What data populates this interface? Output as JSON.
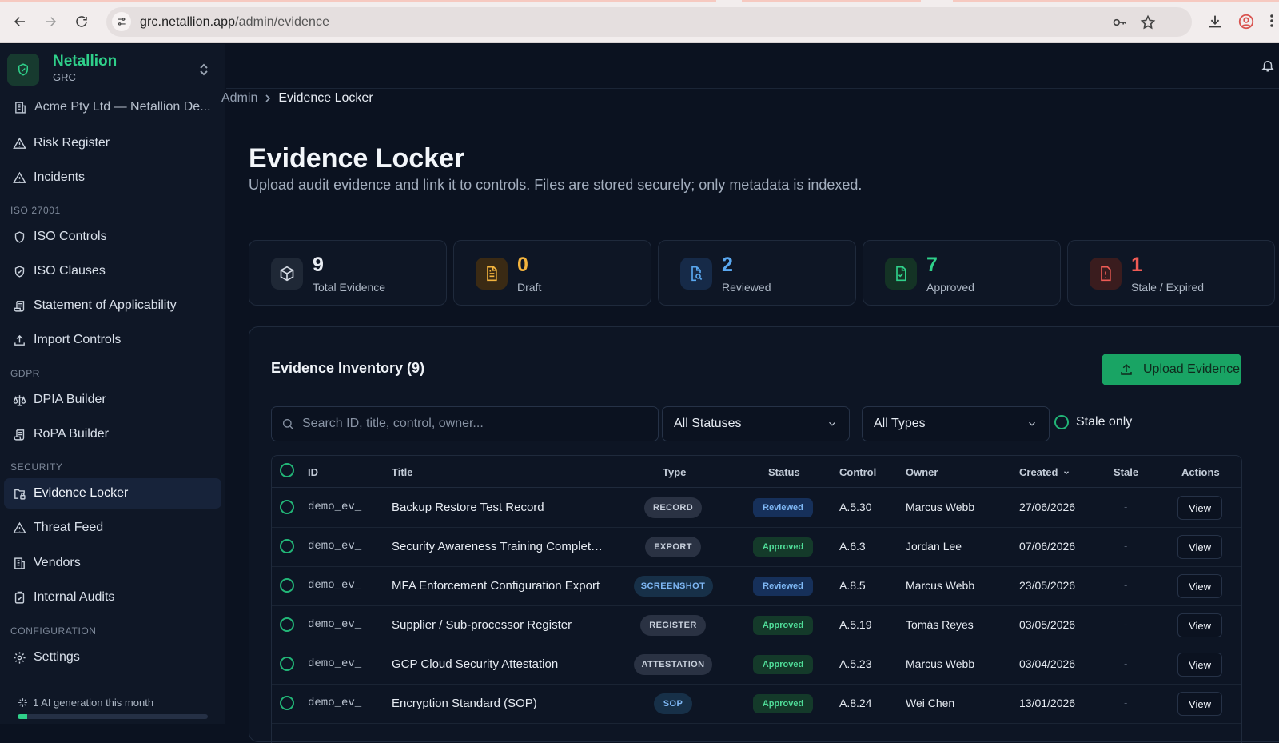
{
  "browser": {
    "url_host": "grc.netallion.app",
    "url_path": "/admin/evidence"
  },
  "brand": {
    "name": "Netallion",
    "sub": "GRC"
  },
  "org": "Acme Pty Ltd — Netallion De...",
  "nav": {
    "risk_register": "Risk Register",
    "incidents": "Incidents",
    "section_iso": "ISO 27001",
    "iso_controls": "ISO Controls",
    "iso_clauses": "ISO Clauses",
    "soa": "Statement of Applicability",
    "import_controls": "Import Controls",
    "section_gdpr": "GDPR",
    "dpia": "DPIA Builder",
    "ropa": "RoPA Builder",
    "section_security": "SECURITY",
    "evidence_locker": "Evidence Locker",
    "threat_feed": "Threat Feed",
    "vendors": "Vendors",
    "internal_audits": "Internal Audits",
    "section_config": "CONFIGURATION",
    "settings": "Settings"
  },
  "ai_usage": {
    "label": "1 AI generation this month",
    "fraction": 0.05
  },
  "breadcrumb": {
    "parent": "Admin",
    "current": "Evidence Locker"
  },
  "page": {
    "title": "Evidence Locker",
    "subtitle": "Upload audit evidence and link it to controls. Files are stored securely; only metadata is indexed."
  },
  "stats": [
    {
      "value": "9",
      "label": "Total Evidence",
      "color": "#e9edf3",
      "icon": "box-icon"
    },
    {
      "value": "0",
      "label": "Draft",
      "color": "#f2b33d",
      "icon": "document-icon"
    },
    {
      "value": "2",
      "label": "Reviewed",
      "color": "#5aa8f0",
      "icon": "file-search-icon"
    },
    {
      "value": "7",
      "label": "Approved",
      "color": "#2fd08a",
      "icon": "file-check-icon"
    },
    {
      "value": "1",
      "label": "Stale / Expired",
      "color": "#ef5b55",
      "icon": "alert-file-icon"
    }
  ],
  "inventory": {
    "title": "Evidence Inventory (9)",
    "upload_label": "Upload Evidence",
    "search_placeholder": "Search ID, title, control, owner...",
    "status_filter": "All Statuses",
    "type_filter": "All Types",
    "stale_only": "Stale only",
    "columns": {
      "id": "ID",
      "title": "Title",
      "type": "Type",
      "status": "Status",
      "control": "Control",
      "owner": "Owner",
      "created": "Created",
      "stale": "Stale",
      "actions": "Actions"
    },
    "rows": [
      {
        "id": "demo_ev_",
        "title": "Backup Restore Test Record",
        "type": "RECORD",
        "status": "Reviewed",
        "control": "A.5.30",
        "owner": "Marcus Webb",
        "created": "27/06/2026",
        "stale": "-",
        "action": "View"
      },
      {
        "id": "demo_ev_",
        "title": "Security Awareness Training Complet…",
        "type": "EXPORT",
        "status": "Approved",
        "control": "A.6.3",
        "owner": "Jordan Lee",
        "created": "07/06/2026",
        "stale": "-",
        "action": "View"
      },
      {
        "id": "demo_ev_",
        "title": "MFA Enforcement Configuration Export",
        "type": "SCREENSHOT",
        "status": "Reviewed",
        "control": "A.8.5",
        "owner": "Marcus Webb",
        "created": "23/05/2026",
        "stale": "-",
        "action": "View"
      },
      {
        "id": "demo_ev_",
        "title": "Supplier / Sub-processor Register",
        "type": "REGISTER",
        "status": "Approved",
        "control": "A.5.19",
        "owner": "Tomás Reyes",
        "created": "03/05/2026",
        "stale": "-",
        "action": "View"
      },
      {
        "id": "demo_ev_",
        "title": "GCP Cloud Security Attestation",
        "type": "ATTESTATION",
        "status": "Approved",
        "control": "A.5.23",
        "owner": "Marcus Webb",
        "created": "03/04/2026",
        "stale": "-",
        "action": "View"
      },
      {
        "id": "demo_ev_",
        "title": "Encryption Standard (SOP)",
        "type": "SOP",
        "status": "Approved",
        "control": "A.8.24",
        "owner": "Wei Chen",
        "created": "13/01/2026",
        "stale": "-",
        "action": "View"
      }
    ]
  },
  "colors": {
    "accent": "#2fd08a",
    "reviewed_bg": "#16305a",
    "reviewed_fg": "#7fb8f5",
    "approved_bg": "#143a2a",
    "approved_fg": "#4fdc98"
  }
}
